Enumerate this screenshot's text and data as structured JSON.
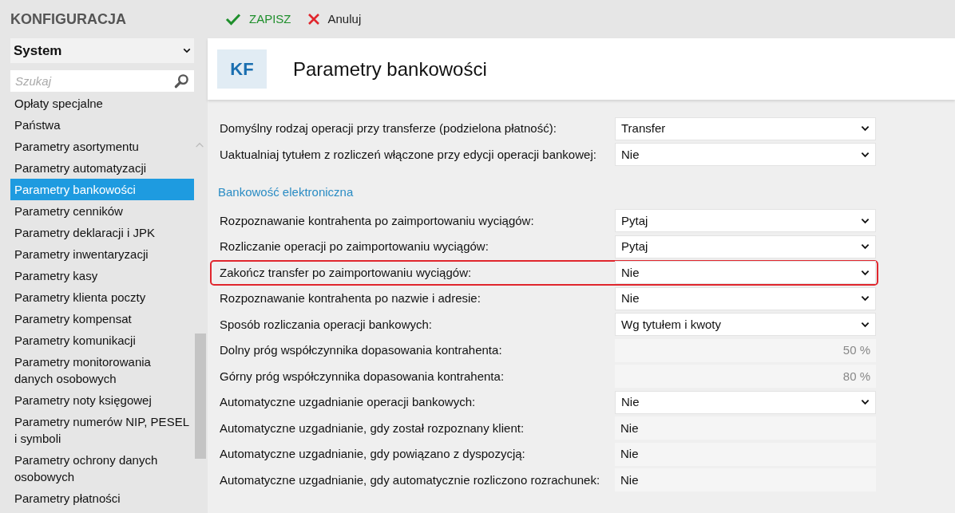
{
  "app_title": "KONFIGURACJA",
  "toolbar": [
    {
      "kind": "save",
      "label": "ZAPISZ"
    },
    {
      "kind": "cancel",
      "label": "Anuluj"
    }
  ],
  "sidebar": {
    "dropdown": "System",
    "search": {
      "placeholder": "Szukaj"
    },
    "items": [
      {
        "label": "Opłaty specjalne",
        "selected": false
      },
      {
        "label": "Państwa",
        "selected": false
      },
      {
        "label": "Parametry asortymentu",
        "selected": false
      },
      {
        "label": "Parametry automatyzacji",
        "selected": false
      },
      {
        "label": "Parametry bankowości",
        "selected": true
      },
      {
        "label": "Parametry cenników",
        "selected": false
      },
      {
        "label": "Parametry deklaracji i JPK",
        "selected": false
      },
      {
        "label": "Parametry inwentaryzacji",
        "selected": false
      },
      {
        "label": "Parametry kasy",
        "selected": false
      },
      {
        "label": "Parametry klienta poczty",
        "selected": false
      },
      {
        "label": "Parametry kompensat",
        "selected": false
      },
      {
        "label": "Parametry komunikacji",
        "selected": false
      },
      {
        "label": "Parametry monitorowania danych osobowych",
        "selected": false
      },
      {
        "label": "Parametry noty księgowej",
        "selected": false
      },
      {
        "label": "Parametry numerów NIP, PESEL i symboli",
        "selected": false
      },
      {
        "label": "Parametry ochrony danych osobowych",
        "selected": false
      },
      {
        "label": "Parametry płatności",
        "selected": false
      }
    ]
  },
  "header": {
    "badge": "KF",
    "title": "Parametry bankowości"
  },
  "sections": [
    {
      "rows": [
        {
          "label": "Domyślny rodzaj operacji przy transferze (podzielona płatność):",
          "value": "Transfer",
          "kind": "select",
          "highlighted": false
        },
        {
          "label": "Uaktualniaj tytułem z rozliczeń włączone przy edycji operacji bankowej:",
          "value": "Nie",
          "kind": "select",
          "highlighted": false
        }
      ]
    },
    {
      "title": "Bankowość elektroniczna",
      "rows": [
        {
          "label": "Rozpoznawanie kontrahenta po zaimportowaniu wyciągów:",
          "value": "Pytaj",
          "kind": "select",
          "highlighted": false
        },
        {
          "label": "Rozliczanie operacji po zaimportowaniu wyciągów:",
          "value": "Pytaj",
          "kind": "select",
          "highlighted": false
        },
        {
          "label": "Zakończ transfer po zaimportowaniu wyciągów:",
          "value": "Nie",
          "kind": "select",
          "highlighted": true
        },
        {
          "label": "Rozpoznawanie kontrahenta po nazwie i adresie:",
          "value": "Nie",
          "kind": "select",
          "highlighted": false
        },
        {
          "label": "Sposób rozliczania operacji bankowych:",
          "value": "Wg tytułem i kwoty",
          "kind": "select",
          "highlighted": false
        },
        {
          "label": "Dolny próg współczynnika dopasowania kontrahenta:",
          "value": "50 %",
          "kind": "number",
          "highlighted": false
        },
        {
          "label": "Górny próg współczynnika dopasowania kontrahenta:",
          "value": "80 %",
          "kind": "number",
          "highlighted": false
        },
        {
          "label": "Automatyczne uzgadnianie operacji bankowych:",
          "value": "Nie",
          "kind": "select",
          "highlighted": false
        },
        {
          "label": "Automatyczne uzgadnianie, gdy został rozpoznany klient:",
          "value": "Nie",
          "kind": "readonly",
          "highlighted": false
        },
        {
          "label": "Automatyczne uzgadnianie, gdy powiązano z dyspozycją:",
          "value": "Nie",
          "kind": "readonly",
          "highlighted": false
        },
        {
          "label": "Automatyczne uzgadnianie, gdy automatycznie rozliczono rozrachunek:",
          "value": "Nie",
          "kind": "readonly",
          "highlighted": false
        }
      ]
    }
  ]
}
